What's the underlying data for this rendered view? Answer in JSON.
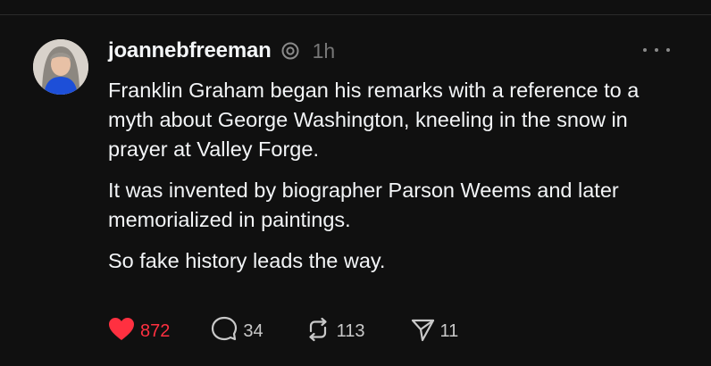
{
  "post": {
    "username": "joannebfreeman",
    "timestamp": "1h",
    "paragraphs": [
      "Franklin Graham began his remarks with a reference to a myth about George Washington, kneeling in the snow in prayer at Valley Forge.",
      "It was invented by biographer Parson Weems and later memorialized in paintings.",
      "So fake history leads the way."
    ]
  },
  "actions": {
    "likes": "872",
    "replies": "34",
    "reposts": "113",
    "shares": "11"
  },
  "icons": {
    "badge": "threads-badge-icon",
    "more": "more-dots-icon",
    "like": "heart-filled-icon",
    "reply": "comment-bubble-icon",
    "repost": "repost-arrows-icon",
    "share": "paper-plane-icon"
  },
  "colors": {
    "background": "#101010",
    "text": "#f3f5f7",
    "muted": "#777777",
    "like_active": "#ff3040"
  }
}
